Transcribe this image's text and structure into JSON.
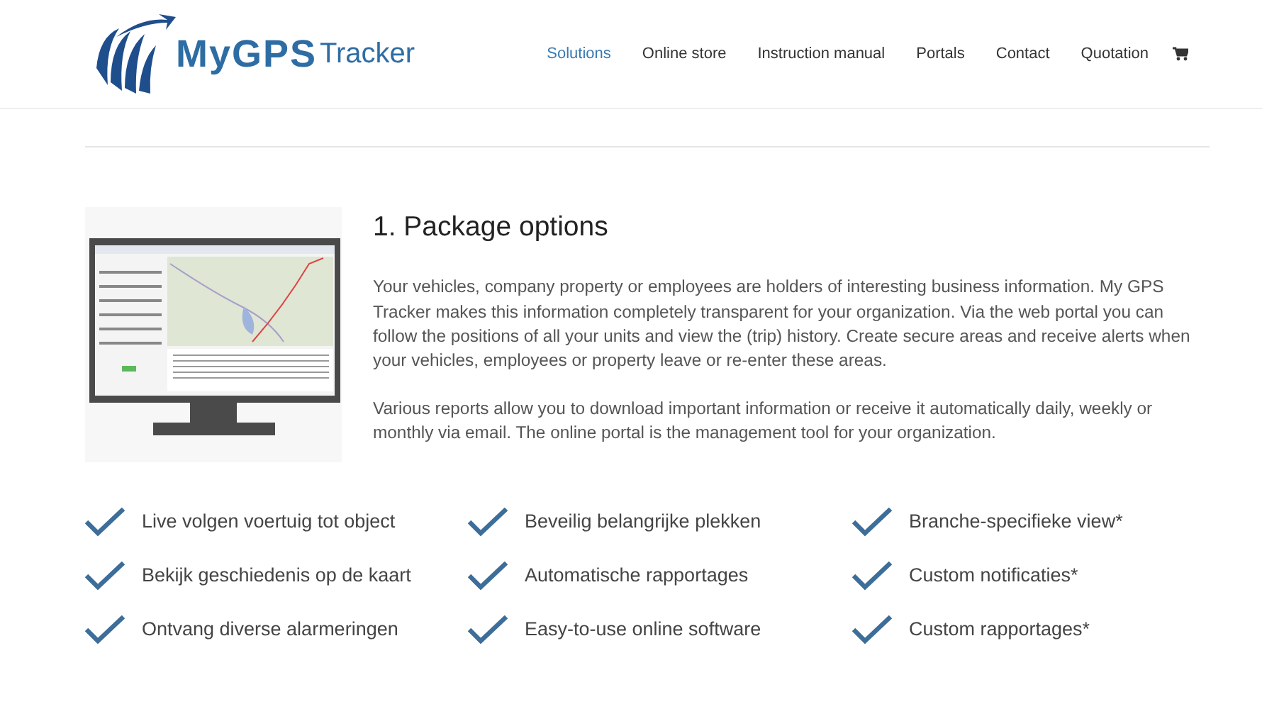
{
  "header": {
    "logo": {
      "brand": "MyGPS",
      "suffix": "Tracker"
    },
    "nav": [
      {
        "label": "Solutions",
        "selected": true
      },
      {
        "label": "Online store",
        "selected": false
      },
      {
        "label": "Instruction manual",
        "selected": false
      },
      {
        "label": "Portals",
        "selected": false
      },
      {
        "label": "Contact",
        "selected": false
      },
      {
        "label": "Quotation",
        "selected": false
      }
    ]
  },
  "section": {
    "title": "1. Package options",
    "paragraphs": [
      "Your vehicles, company property or employees are holders of interesting business information. My GPS Tracker makes this information completely transparent for your organization. Via the web portal you can follow the positions of all your units and view the (trip) history. Create secure areas and receive alerts when your vehicles, employees or property leave or re-enter these areas.",
      "Various reports allow you to download important information or receive it automatically daily, weekly or monthly via email. The online portal is the management tool for your organization."
    ]
  },
  "features": [
    "Live volgen voertuig tot object",
    "Beveilig belangrijke plekken",
    "Branche-specifieke view*",
    "Bekijk geschiedenis op de kaart",
    "Automatische rapportages",
    "Custom notificaties*",
    "Ontvang diverse alarmeringen",
    "Easy-to-use online software",
    "Custom rapportages*"
  ]
}
